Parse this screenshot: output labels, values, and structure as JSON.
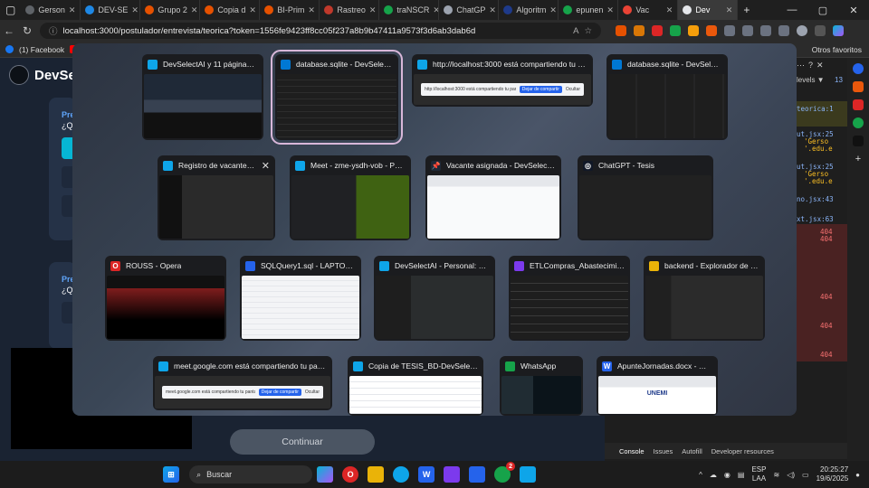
{
  "browser": {
    "tabs": [
      {
        "label": "Gerson",
        "color": "#5f6368"
      },
      {
        "label": "DEV-SE",
        "color": "#1e88e5"
      },
      {
        "label": "Grupo 2",
        "color": "#e65100"
      },
      {
        "label": "Copia d",
        "color": "#e65100"
      },
      {
        "label": "BI-Prim",
        "color": "#e65100"
      },
      {
        "label": "Rastreo",
        "color": "#c0392b"
      },
      {
        "label": "traNSCR",
        "color": "#16a34a"
      },
      {
        "label": "ChatGP",
        "color": "#9ca3af"
      },
      {
        "label": "Algoritm",
        "color": "#1e3a8a"
      },
      {
        "label": "epunen",
        "color": "#16a34a"
      },
      {
        "label": "Vac",
        "color": "#ea4335"
      },
      {
        "label": "Dev",
        "color": "#e5e7eb"
      }
    ],
    "url": "localhost:3000/postulador/entrevista/teorica?token=1556fe9423ff8cc05f237a8b9b47411a9573f3d6ab3dab6d",
    "bookmark_facebook": "(1) Facebook",
    "bookmark_others": "Otros favoritos"
  },
  "app": {
    "brand": "DevSe",
    "section1_label": "Pre",
    "section1_q": "¿Q",
    "section2_label": "Pre",
    "section2_q": "¿Q",
    "continue_button": "Continuar"
  },
  "devtools": {
    "levels": "levels ▼",
    "badge": "13",
    "lines": [
      "teorica:1",
      "ut.jsx:25",
      "'Gerso",
      "'.edu.e",
      "ut.jsx:25",
      "'Gerso",
      "'.edu.e",
      "no.jsx:43",
      "xt.jsx:63",
      "404",
      "404",
      "404",
      "404",
      "404"
    ],
    "tabs": [
      "Console",
      "Issues",
      "Autofill",
      "Developer resources"
    ]
  },
  "task_view": {
    "windows": [
      {
        "title": "DevSelectAI y 11 páginas más...",
        "icon": "edge"
      },
      {
        "title": "database.sqlite - DevSelectAI...",
        "icon": "vscode"
      },
      {
        "title": "http://localhost:3000 está compartiendo tu pant...",
        "icon": "edge"
      },
      {
        "title": "database.sqlite - DevSelectAI...",
        "icon": "vscode"
      },
      {
        "title": "Registro de vacante - P...",
        "icon": "edge"
      },
      {
        "title": "Meet - zme-ysdh-vob - Pers...",
        "icon": "edge"
      },
      {
        "title": "Vacante asignada - DevSelectA...",
        "icon": "pin"
      },
      {
        "title": "ChatGPT - Tesis",
        "icon": "chatgpt"
      },
      {
        "title": "ROUSS - Opera",
        "icon": "opera"
      },
      {
        "title": "SQLQuery1.sql - LAPTOP-SRP...",
        "icon": "ssms"
      },
      {
        "title": "DevSelectAI - Personal: Micr...",
        "icon": "edge"
      },
      {
        "title": "ETLCompras_Abastecimiento...",
        "icon": "vs"
      },
      {
        "title": "backend - Explorador de arc...",
        "icon": "folder"
      },
      {
        "title": "meet.google.com está compartiendo tu pantalla.",
        "icon": "edge"
      },
      {
        "title": "Copia de TESIS_BD-DevSelectAI2...",
        "icon": "edge"
      },
      {
        "title": "WhatsApp",
        "icon": "whatsapp"
      },
      {
        "title": "ApunteJornadas.docx - Word",
        "icon": "word"
      }
    ],
    "share_text_1": "http://localhost:3000 está compartiendo tu pantalla.",
    "share_stop_1": "Dejar de compartir",
    "share_hide_1": "Ocultar",
    "share_text_2": "meet.google.com está compartiendo tu pantalla.",
    "share_stop_2": "Dejar de compartir",
    "share_hide_2": "Ocultar",
    "word_thumb_text": "UNEMI"
  },
  "taskbar": {
    "search_placeholder": "Buscar",
    "lang": "ESP",
    "lang2": "LAA",
    "time": "20:25:27",
    "date": "19/6/2025",
    "whatsapp_badge": "2"
  }
}
